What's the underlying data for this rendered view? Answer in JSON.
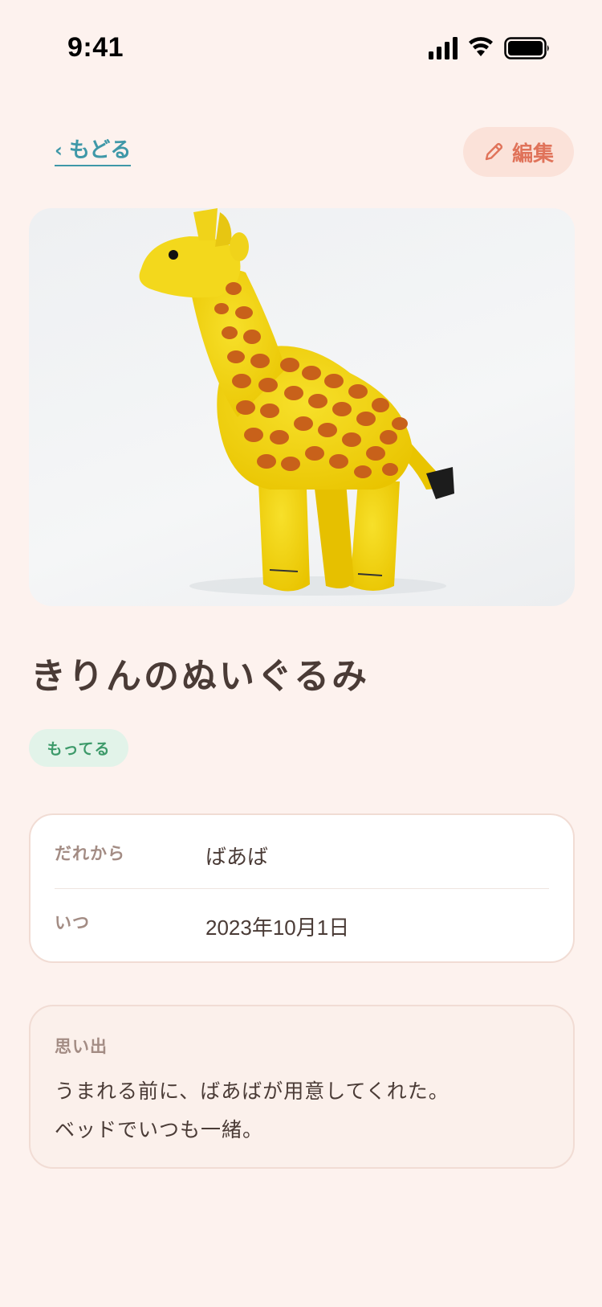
{
  "status_bar": {
    "time": "9:41"
  },
  "nav": {
    "back_label": "もどる",
    "back_chevron": "‹",
    "edit_label": "編集",
    "edit_icon": "pencil-icon"
  },
  "colors": {
    "background": "#fdf2ee",
    "accent_link": "#3f98a8",
    "edit_accent": "#e0735a",
    "badge_green": "#3d9a6a"
  },
  "item": {
    "title": "きりんのぬいぐるみ",
    "status_badge": "もってる",
    "photo_subject": "giraffe plush toy"
  },
  "details": {
    "from_label": "だれから",
    "from_value": "ばあば",
    "when_label": "いつ",
    "when_value": "2023年10月1日"
  },
  "memory": {
    "label": "思い出",
    "line1": "うまれる前に、ばあばが用意してくれた。",
    "line2": "ベッドでいつも一緒。"
  }
}
